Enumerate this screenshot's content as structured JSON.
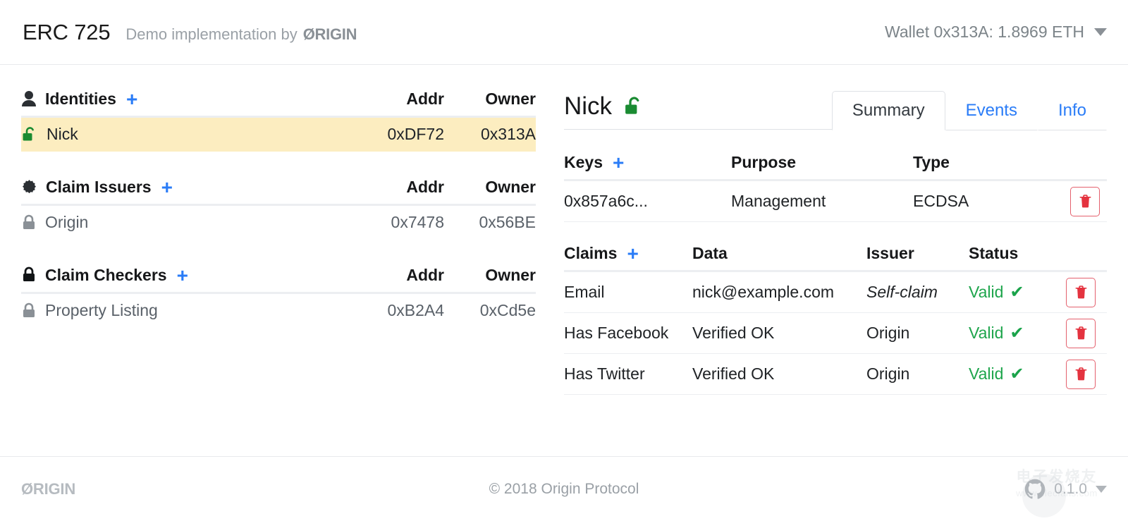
{
  "header": {
    "app_title": "ERC 725",
    "subtitle_prefix": "Demo implementation by",
    "brand": "ØRIGIN",
    "wallet": "Wallet 0x313A: 1.8969 ETH",
    "wallet_caret_icon": "chevron-down-icon"
  },
  "left": {
    "sections": [
      {
        "icon": "person-icon",
        "title": "Identities",
        "add_label": "+",
        "col_addr": "Addr",
        "col_owner": "Owner",
        "rows": [
          {
            "icon": "unlock-icon-green",
            "label": "Nick",
            "addr": "0xDF72",
            "owner": "0x313A",
            "selected": true
          }
        ]
      },
      {
        "icon": "certificate-icon",
        "title": "Claim Issuers",
        "add_label": "+",
        "col_addr": "Addr",
        "col_owner": "Owner",
        "rows": [
          {
            "icon": "lock-icon-gray",
            "label": "Origin",
            "addr": "0x7478",
            "owner": "0x56BE",
            "selected": false
          }
        ]
      },
      {
        "icon": "lock-icon-black",
        "title": "Claim Checkers",
        "add_label": "+",
        "col_addr": "Addr",
        "col_owner": "Owner",
        "rows": [
          {
            "icon": "lock-icon-gray",
            "label": "Property Listing",
            "addr": "0xB2A4",
            "owner": "0xCd5e",
            "selected": false
          }
        ]
      }
    ]
  },
  "right": {
    "identity_name": "Nick",
    "identity_icon": "unlock-icon-green",
    "tabs": [
      {
        "label": "Summary",
        "active": true
      },
      {
        "label": "Events",
        "active": false
      },
      {
        "label": "Info",
        "active": false
      }
    ],
    "keys_table": {
      "header": {
        "title": "Keys",
        "add_label": "+",
        "purpose": "Purpose",
        "type": "Type"
      },
      "rows": [
        {
          "key": "0x857a6c...",
          "purpose": "Management",
          "type": "ECDSA",
          "delete_icon": "trash-icon"
        }
      ]
    },
    "claims_table": {
      "header": {
        "title": "Claims",
        "add_label": "+",
        "data": "Data",
        "issuer": "Issuer",
        "status": "Status"
      },
      "rows": [
        {
          "claim": "Email",
          "data": "nick@example.com",
          "issuer": "Self-claim",
          "issuer_italic": true,
          "status": "Valid",
          "status_icon": "check-icon",
          "delete_icon": "trash-icon"
        },
        {
          "claim": "Has Facebook",
          "data": "Verified OK",
          "issuer": "Origin",
          "issuer_italic": false,
          "status": "Valid",
          "status_icon": "check-icon",
          "delete_icon": "trash-icon"
        },
        {
          "claim": "Has Twitter",
          "data": "Verified OK",
          "issuer": "Origin",
          "issuer_italic": false,
          "status": "Valid",
          "status_icon": "check-icon",
          "delete_icon": "trash-icon"
        }
      ]
    }
  },
  "footer": {
    "brand": "ØRIGIN",
    "copyright": "© 2018  Origin Protocol",
    "version": "0.1.0",
    "github_icon": "github-icon",
    "version_caret_icon": "chevron-down-icon",
    "watermark_cn": "电子发烧友",
    "watermark_url": "www.elecfans.com"
  },
  "colors": {
    "accent_blue": "#2a7cf7",
    "valid_green": "#1ea54c",
    "danger_red": "#e4606d",
    "selected_row": "#fcedc0",
    "muted_text": "#9aa0a6"
  }
}
